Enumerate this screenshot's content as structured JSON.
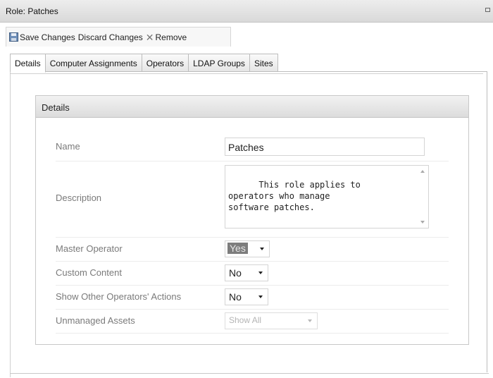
{
  "window": {
    "title": "Role: Patches"
  },
  "toolbar": {
    "save_label": "Save Changes",
    "discard_label": "Discard Changes",
    "remove_label": "Remove"
  },
  "tabs": [
    {
      "label": "Details",
      "active": true
    },
    {
      "label": "Computer Assignments"
    },
    {
      "label": "Operators"
    },
    {
      "label": "LDAP Groups"
    },
    {
      "label": "Sites"
    }
  ],
  "panel": {
    "title": "Details",
    "fields": {
      "name": {
        "label": "Name",
        "value": "Patches"
      },
      "description": {
        "label": "Description",
        "value": "This role applies to\noperators who manage\nsoftware patches."
      },
      "master_operator": {
        "label": "Master Operator",
        "value": "Yes"
      },
      "custom_content": {
        "label": "Custom Content",
        "value": "No"
      },
      "show_other_actions": {
        "label": "Show Other Operators' Actions",
        "value": "No"
      },
      "unmanaged_assets": {
        "label": "Unmanaged Assets",
        "value": "Show All"
      }
    }
  }
}
